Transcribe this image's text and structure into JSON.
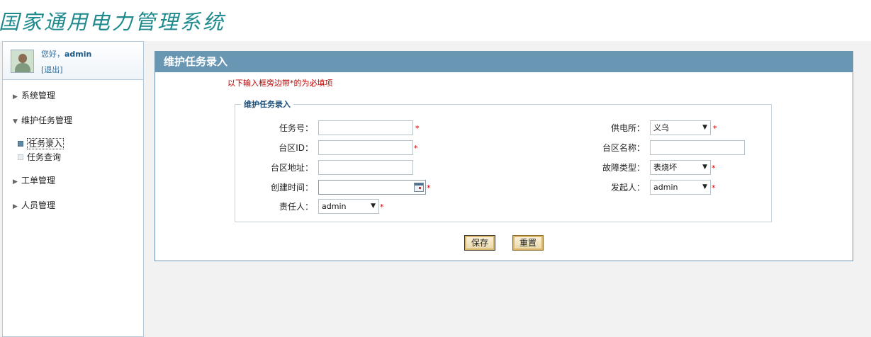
{
  "header": {
    "logo_text": "国家通用电力管理系统"
  },
  "user": {
    "greeting": "您好，",
    "username": "admin",
    "logout": "[退出]"
  },
  "sidebar": {
    "menu": [
      {
        "label": "系统管理"
      },
      {
        "label": "维护任务管理"
      },
      {
        "label": "工单管理"
      },
      {
        "label": "人员管理"
      }
    ],
    "submenu": [
      {
        "label": "任务录入"
      },
      {
        "label": "任务查询"
      }
    ]
  },
  "panel": {
    "title": "维护任务录入",
    "note": "以下输入框旁边带*的为必填项",
    "legend": "维护任务录入"
  },
  "form": {
    "task_no_label": "任务号：",
    "area_id_label": "台区ID：",
    "area_addr_label": "台区地址：",
    "created_time_label": "创建时间：",
    "owner_label": "责任人：",
    "owner_value": "admin",
    "station_label": "供电所：",
    "station_value": "义乌",
    "area_name_label": "台区名称：",
    "fault_type_label": "故障类型：",
    "fault_type_value": "表烧坏",
    "initiator_label": "发起人：",
    "initiator_value": "admin",
    "required_mark": "*"
  },
  "buttons": {
    "save": "保存",
    "reset": "重置"
  },
  "icons": {
    "menu_collapsed": "triangle-right-icon",
    "menu_expanded": "triangle-down-icon",
    "calendar": "calendar-icon",
    "dropdown": "chevron-down-icon"
  }
}
